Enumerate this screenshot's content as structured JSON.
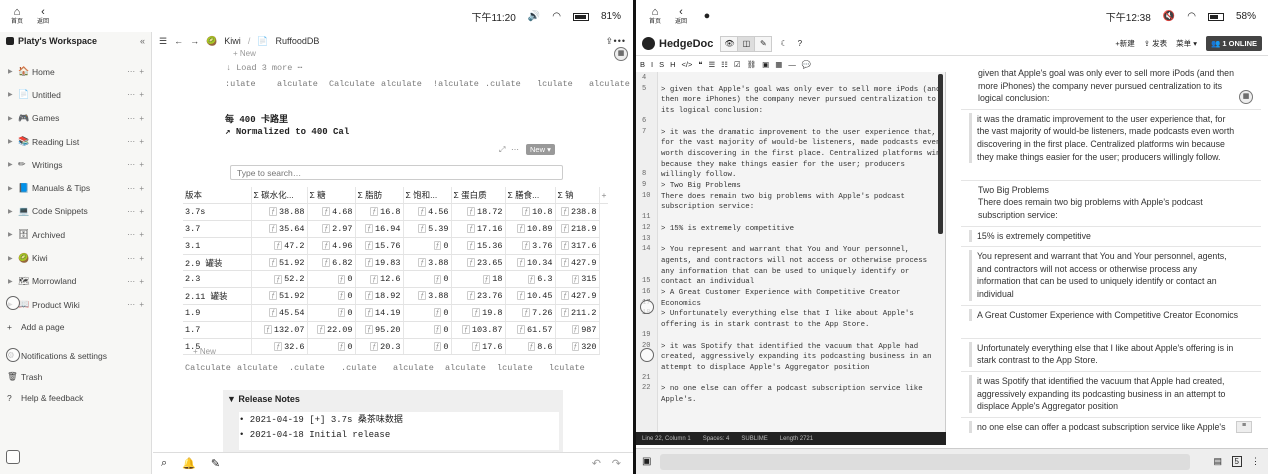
{
  "left_status": {
    "home": "首页",
    "back": "返回",
    "time": "下午11:20",
    "battery": "81%"
  },
  "right_status": {
    "home": "首页",
    "back": "返回",
    "time": "下午12:38",
    "battery": "58%"
  },
  "sidebar": {
    "workspace": "Platy's Workspace",
    "items": [
      {
        "label": "Home",
        "icon": "🏠"
      },
      {
        "label": "Untitled",
        "icon": "📄"
      },
      {
        "label": "Games",
        "icon": "🎮"
      },
      {
        "label": "Reading List",
        "icon": "📚"
      },
      {
        "label": "Writings",
        "icon": "✏"
      },
      {
        "label": "Manuals & Tips",
        "icon": "📘"
      },
      {
        "label": "Code Snippets",
        "icon": "💻"
      },
      {
        "label": "Archived",
        "icon": "🗄"
      },
      {
        "label": "Kiwi",
        "icon": "🥝"
      },
      {
        "label": "Morrowland",
        "icon": "🗺"
      },
      {
        "label": "Product Wiki",
        "icon": "📖"
      }
    ],
    "add_page": "Add a page",
    "notifications": "Notifications & settings",
    "trash": "Trash",
    "help": "Help & feedback"
  },
  "breadcrumb": {
    "first": "Kiwi",
    "second": "RuffoodDB"
  },
  "doc": {
    "new_top": "+ New",
    "load_more": "Load 3 more",
    "calc_row": [
      ":ulate",
      "alculate",
      "Calculate",
      "alculate",
      "!alculate",
      ".culate",
      "lculate",
      "alculate"
    ],
    "line_cn": "每 400 卡路里",
    "line_norm": "↗ Normalized to 400 Cal",
    "new_button": "New",
    "search_placeholder": "Type to search…",
    "columns": [
      "版本",
      "Σ 碳水化...",
      "Σ 糖",
      "Σ 脂肪",
      "Σ 饱和...",
      "Σ 蛋白质",
      "Σ 膳食...",
      "Σ 钠"
    ],
    "rows": [
      {
        "name": "3.7s",
        "v": [
          "38.88",
          "4.68",
          "16.8",
          "4.56",
          "18.72",
          "10.8",
          "238.8"
        ]
      },
      {
        "name": "3.7",
        "v": [
          "35.64",
          "2.97",
          "16.94",
          "5.39",
          "17.16",
          "10.89",
          "218.9"
        ]
      },
      {
        "name": "3.1",
        "v": [
          "47.2",
          "4.96",
          "15.76",
          "0",
          "15.36",
          "3.76",
          "317.6"
        ]
      },
      {
        "name": "2.9 罐装",
        "v": [
          "51.92",
          "6.82",
          "19.83",
          "3.88",
          "23.65",
          "10.34",
          "427.9"
        ]
      },
      {
        "name": "2.3",
        "v": [
          "52.2",
          "0",
          "12.6",
          "0",
          "18",
          "6.3",
          "315"
        ]
      },
      {
        "name": "2.11 罐装",
        "v": [
          "51.92",
          "0",
          "18.92",
          "3.88",
          "23.76",
          "10.45",
          "427.9"
        ]
      },
      {
        "name": "1.9",
        "v": [
          "45.54",
          "0",
          "14.19",
          "0",
          "19.8",
          "7.26",
          "211.2"
        ]
      },
      {
        "name": "1.7",
        "v": [
          "132.07",
          "22.09",
          "95.20",
          "0",
          "103.87",
          "61.57",
          "987"
        ]
      },
      {
        "name": "1.5",
        "v": [
          "32.6",
          "0",
          "20.3",
          "0",
          "17.6",
          "8.6",
          "320"
        ]
      }
    ],
    "new_bottom": "+ New",
    "calc_row2": [
      "Calculate",
      "alculate",
      ".culate",
      ".culate",
      "alculate",
      "alculate",
      "lculate",
      "lculate"
    ],
    "release_title": "▼ Release Notes",
    "releases": [
      "• 2021-04-19 [+] 3.7s 桑茶味数据",
      "• 2021-04-18 Initial release"
    ]
  },
  "hedgedoc": {
    "name": "HedgeDoc",
    "new_label": "+新建",
    "publish_label": "发表",
    "menu_label": "菜单 ▾",
    "online": "1 ONLINE",
    "toolbar": [
      "B",
      "I",
      "S",
      "H",
      "</>",
      "❝",
      "☰",
      "☷",
      "☑",
      "⛓",
      "▣",
      "▦",
      "—",
      "💬"
    ],
    "editor_lines": [
      {
        "n": "4",
        "t": ""
      },
      {
        "n": "5",
        "t": "> given that Apple's goal was only ever to sell more iPods (and then more iPhones) the company never pursued centralization to its logical conclusion:"
      },
      {
        "n": "6",
        "t": ""
      },
      {
        "n": "7",
        "t": "> it was the dramatic improvement to the user experience that, for the vast majority of would-be listeners, made podcasts even worth discovering in the first place. Centralized platforms win because they make things easier for the user; producers willingly follow."
      },
      {
        "n": "8",
        "t": ""
      },
      {
        "n": "9",
        "t": "> Two Big Problems"
      },
      {
        "n": "10",
        "t": "There does remain two big problems with Apple's podcast subscription service:"
      },
      {
        "n": "11",
        "t": ""
      },
      {
        "n": "12",
        "t": "> 15% is extremely competitive"
      },
      {
        "n": "13",
        "t": ""
      },
      {
        "n": "14",
        "t": "> You represent and warrant that You and Your personnel, agents, and contractors will not access or otherwise process any information that can be used to uniquely identify or contact an individual"
      },
      {
        "n": "15",
        "t": ""
      },
      {
        "n": "16",
        "t": "> A Great Customer Experience with Competitive Creator Economics"
      },
      {
        "n": "17",
        "t": ""
      },
      {
        "n": "18",
        "t": "> Unfortunately everything else that I like about Apple's offering is in stark contrast to the App Store."
      },
      {
        "n": "19",
        "t": ""
      },
      {
        "n": "20",
        "t": "> it was Spotify that identified the vacuum that Apple had created, aggressively expanding its podcasting business in an attempt to displace Apple's Aggregator position"
      },
      {
        "n": "21",
        "t": ""
      },
      {
        "n": "22",
        "t": "> no one else can offer a podcast subscription service like Apple's."
      }
    ],
    "status_items": [
      "Line 22, Column 1",
      "Spaces: 4",
      "SUBLIME",
      "Length 2721"
    ],
    "preview": [
      {
        "t": "given that Apple's goal was only ever to sell more iPods (and then more iPhones) the company never pursued centralization to its logical conclusion:",
        "bq": false
      },
      {
        "t": "it was the dramatic improvement to the user experience that, for the vast majority of would-be listeners, made podcasts even worth discovering in the first place. Centralized platforms win because they make things easier for the user; producers willingly follow.",
        "bq": true
      },
      {
        "t": "Two Big Problems\nThere does remain two big problems with Apple's podcast subscription service:",
        "bq": false
      },
      {
        "t": "15% is extremely competitive",
        "bq": true
      },
      {
        "t": "You represent and warrant that You and Your personnel, agents, and contractors will not access or otherwise process any information that can be used to uniquely identify or contact an individual",
        "bq": true
      },
      {
        "t": "A Great Customer Experience with Competitive Creator Economics",
        "bq": true
      },
      {
        "t": "Unfortunately everything else that I like about Apple's offering is in stark contrast to the App Store.",
        "bq": true
      },
      {
        "t": "it was Spotify that identified the vacuum that Apple had created, aggressively expanding its podcasting business in an attempt to displace Apple's Aggregator position",
        "bq": true
      },
      {
        "t": "no one else can offer a podcast subscription service like Apple's",
        "bq": true
      }
    ]
  }
}
